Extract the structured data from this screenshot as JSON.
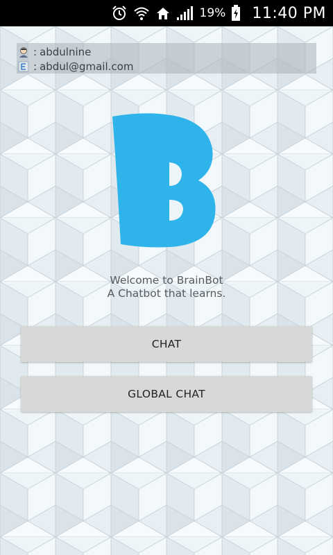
{
  "status_bar": {
    "battery_percent": "19%",
    "time": "11:40 PM",
    "icons": [
      "alarm-icon",
      "wifi-icon",
      "home-icon",
      "signal-icon",
      "battery-charging-icon"
    ]
  },
  "profile": {
    "username_prefix": ": ",
    "username": "abdulnine",
    "email_prefix": ": ",
    "email": "abdul@gmail.com",
    "icons": [
      "user-avatar-icon",
      "email-icon"
    ]
  },
  "logo": {
    "letter": "B",
    "color": "#2eb4ea"
  },
  "welcome": {
    "line1": "Welcome to BrainBot",
    "line2": "A Chatbot that learns."
  },
  "buttons": {
    "chat_label": "CHAT",
    "global_chat_label": "GLOBAL CHAT"
  },
  "colors": {
    "status_bar": "#000000",
    "background": "#eef4f8",
    "button": "#d7d8d8",
    "accent": "#2eb4ea"
  }
}
